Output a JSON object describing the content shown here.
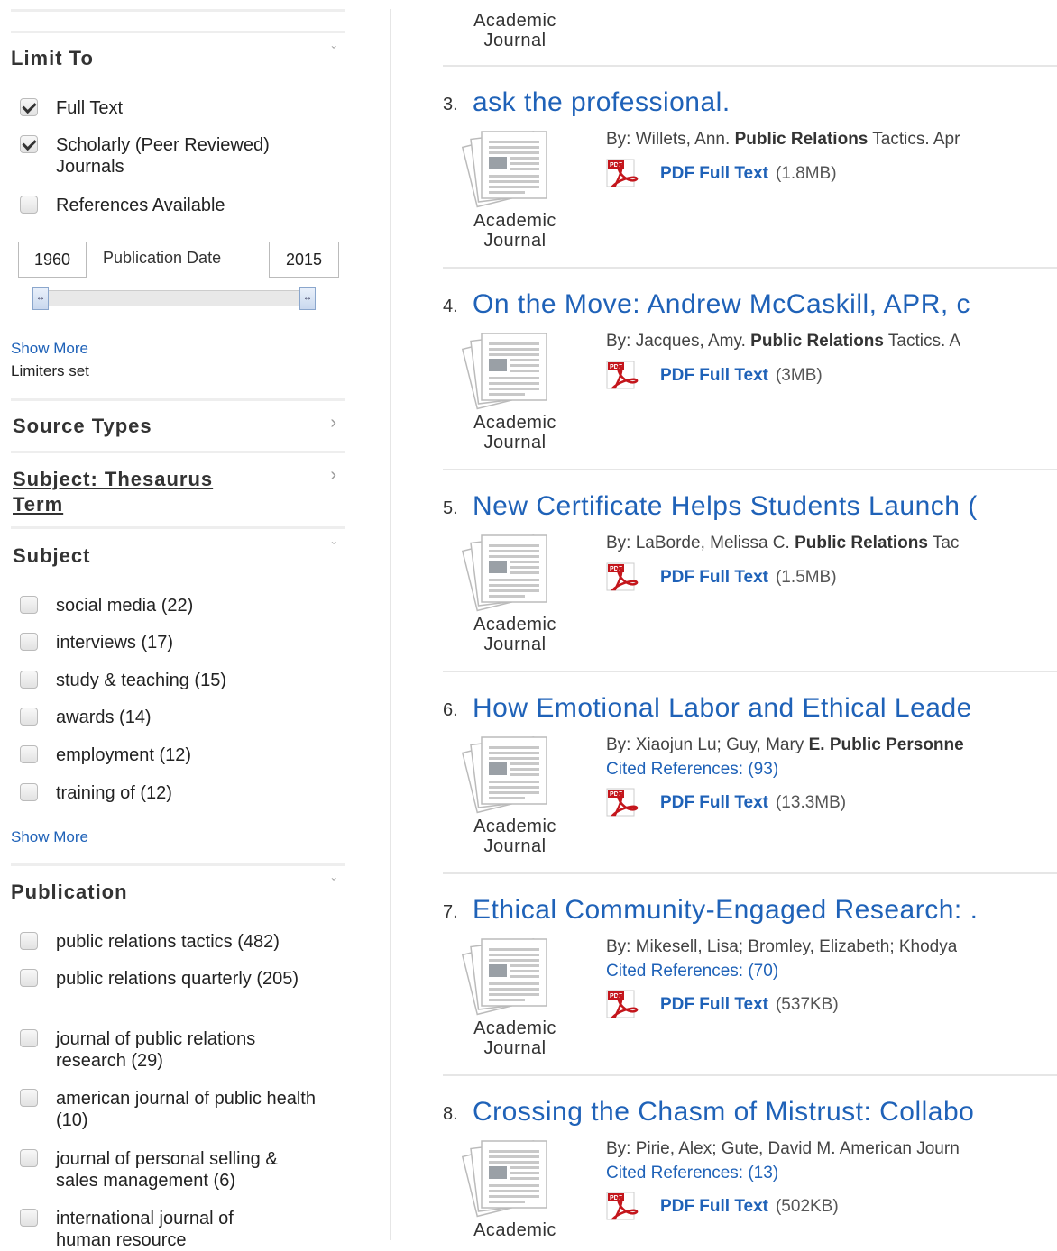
{
  "sidebar": {
    "limit_to": {
      "title": "Limit To",
      "items": [
        {
          "label": "Full Text",
          "checked": true
        },
        {
          "label": "Scholarly (Peer Reviewed) Journals",
          "checked": true
        },
        {
          "label": "References Available",
          "checked": false
        }
      ],
      "date_from": "1960",
      "date_label": "Publication Date",
      "date_to": "2015",
      "slider_left_glyph": "↔",
      "slider_right_glyph": "↔",
      "show_more": "Show More",
      "limiters_set": "Limiters set"
    },
    "source_types": {
      "title": "Source Types"
    },
    "thesaurus": {
      "title_line1": "Subject: Thesaurus",
      "title_line2": "Term"
    },
    "subject": {
      "title": "Subject",
      "items": [
        "social media (22)",
        "interviews (17)",
        "study & teaching (15)",
        "awards (14)",
        "employment (12)",
        "training of (12)"
      ],
      "show_more": "Show More"
    },
    "publication": {
      "title": "Publication",
      "items": [
        "public relations tactics (482)",
        "public relations quarterly (205)",
        "journal of public relations research (29)",
        "american journal of public health (10)",
        "journal of personal selling & sales management (6)",
        "international journal of human resource"
      ]
    },
    "chevron_down": "ˇ",
    "chevron_right": "›"
  },
  "results": {
    "top_pubtype_line1": "Academic",
    "top_pubtype_line2": "Journal",
    "items": [
      {
        "num": "3.",
        "title": "ask the professional.",
        "by": "By: Willets, Ann.",
        "source_bold": "Public Relations",
        "source_rest": " Tactics. Apr",
        "cited": "",
        "pdf_label": "PDF Full Text",
        "pdf_size": "(1.8MB)",
        "pubtype1": "Academic",
        "pubtype2": "Journal"
      },
      {
        "num": "4.",
        "title": "On the Move: Andrew McCaskill, APR, c",
        "by": "By: Jacques, Amy.",
        "source_bold": "Public Relations",
        "source_rest": " Tactics. A",
        "cited": "",
        "pdf_label": "PDF Full Text",
        "pdf_size": "(3MB)",
        "pubtype1": "Academic",
        "pubtype2": "Journal"
      },
      {
        "num": "5.",
        "title": "New Certificate Helps Students Launch (",
        "by": "By: LaBorde, Melissa C.",
        "source_bold": "Public Relations",
        "source_rest": " Tac",
        "cited": "",
        "pdf_label": "PDF Full Text",
        "pdf_size": "(1.5MB)",
        "pubtype1": "Academic",
        "pubtype2": "Journal"
      },
      {
        "num": "6.",
        "title": "How Emotional Labor and Ethical Leade",
        "by": "By: Xiaojun Lu; Guy, Mary",
        "source_bold": "E. Public Personne",
        "source_rest": "",
        "cited": "Cited References: (93)",
        "pdf_label": "PDF Full Text",
        "pdf_size": "(13.3MB)",
        "pubtype1": "Academic",
        "pubtype2": "Journal"
      },
      {
        "num": "7.",
        "title": "Ethical Community-Engaged Research: .",
        "by": "By: Mikesell, Lisa; Bromley, Elizabeth; Khodya",
        "source_bold": "",
        "source_rest": "",
        "cited": "Cited References: (70)",
        "pdf_label": "PDF Full Text",
        "pdf_size": "(537KB)",
        "pubtype1": "Academic",
        "pubtype2": "Journal"
      },
      {
        "num": "8.",
        "title": "Crossing the Chasm of Mistrust: Collabo",
        "by": "By: Pirie, Alex; Gute, David M. American Journ",
        "source_bold": "",
        "source_rest": "",
        "cited": "Cited References: (13)",
        "pdf_label": "PDF Full Text",
        "pdf_size": "(502KB)",
        "pubtype1": "Academic",
        "pubtype2": ""
      }
    ]
  },
  "colors": {
    "link": "#1f62b8",
    "pdf_red": "#c4161c"
  }
}
